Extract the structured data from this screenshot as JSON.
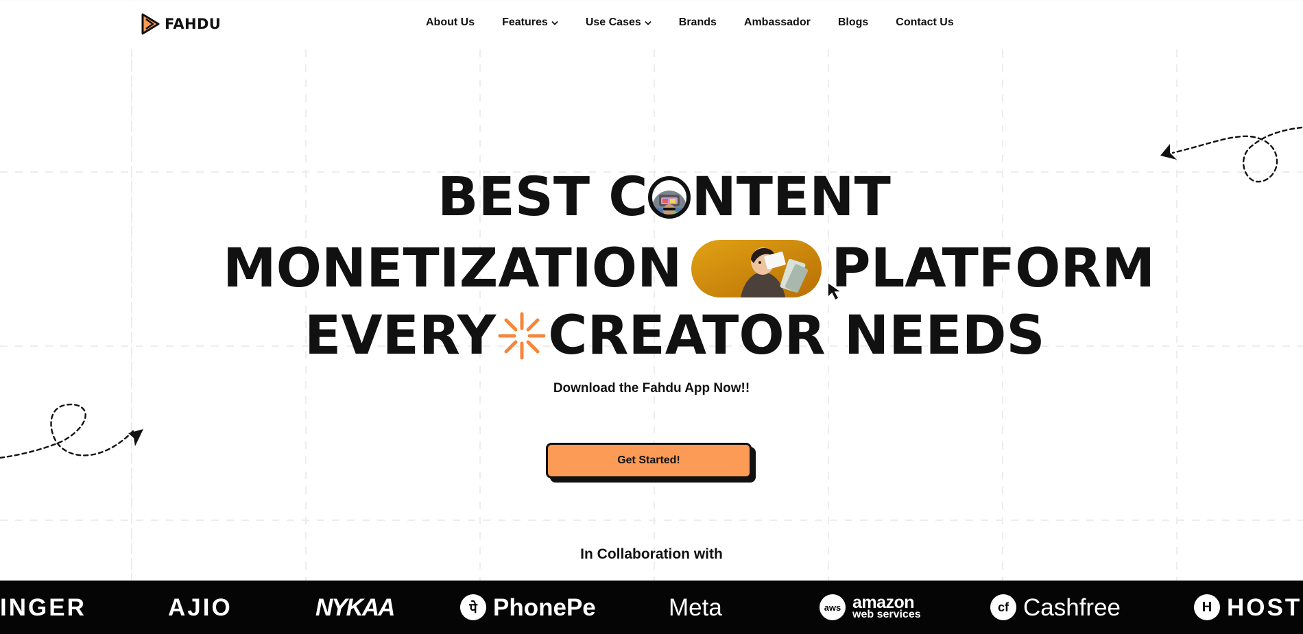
{
  "brand": {
    "name": "FAHDU"
  },
  "nav": {
    "items": [
      {
        "label": "About Us",
        "has_dropdown": false
      },
      {
        "label": "Features",
        "has_dropdown": true
      },
      {
        "label": "Use Cases",
        "has_dropdown": true
      },
      {
        "label": "Brands",
        "has_dropdown": false
      },
      {
        "label": "Ambassador",
        "has_dropdown": false
      },
      {
        "label": "Blogs",
        "has_dropdown": false
      },
      {
        "label": "Contact Us",
        "has_dropdown": false
      }
    ]
  },
  "hero": {
    "line1_a": "BEST C",
    "line1_b": "NTENT",
    "line2_a": "MONETIZATION",
    "line2_b": "PLATFORM",
    "line3_a": "EVERY",
    "line3_b": "CREATOR NEEDS",
    "subtitle": "Download the Fahdu App Now!!",
    "cta_label": "Get Started!"
  },
  "collaboration": {
    "heading": "In Collaboration with",
    "logos": [
      {
        "name": "INGER",
        "style": "bold"
      },
      {
        "name": "AJIO",
        "style": "bold"
      },
      {
        "name": "NYKAA",
        "style": "italic"
      },
      {
        "name": "PhonePe",
        "style": "badge",
        "badge": "पे"
      },
      {
        "name": "Meta",
        "style": "regular"
      },
      {
        "name": "amazon",
        "sub": "web services",
        "style": "aws",
        "badge": "aws"
      },
      {
        "name": "Cashfree",
        "style": "badge",
        "badge": "cf"
      },
      {
        "name": "HOST",
        "style": "badge",
        "badge": "H"
      }
    ]
  },
  "colors": {
    "accent": "#fc9b55",
    "text": "#111111",
    "strip_background": "#050505",
    "spark": "#f4873c"
  },
  "icons": {
    "brand_logo": "play-triangle-icon",
    "dropdown": "chevron-down-icon",
    "sparkle": "sparkle-icon",
    "arrow": "dashed-arrow-icon",
    "cursor": "mouse-pointer-icon"
  }
}
